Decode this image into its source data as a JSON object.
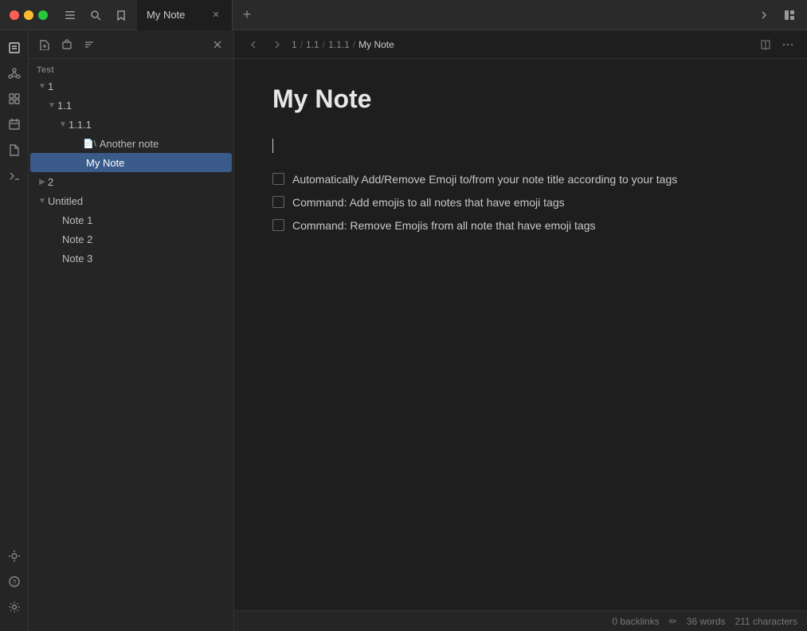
{
  "titlebar": {
    "tab_label": "My Note",
    "new_tab_label": "+"
  },
  "toolbar": {
    "new_note_label": "✎",
    "move_label": "⊞",
    "sort_label": "≡",
    "close_label": "✕"
  },
  "sidebar_icons": {
    "notes_icon": "📝",
    "graph_icon": "⬡",
    "grid_icon": "⊞",
    "calendar_icon": "📅",
    "file_icon": "📄",
    "terminal_icon": ">_",
    "plugin_icon": "⚙",
    "help_icon": "?",
    "settings_icon": "⚙"
  },
  "file_tree": {
    "section_label": "Test",
    "items": [
      {
        "id": "1",
        "label": "1",
        "level": 0,
        "type": "folder",
        "expanded": true,
        "chevron": "▼"
      },
      {
        "id": "1.1",
        "label": "1.1",
        "level": 1,
        "type": "folder",
        "expanded": true,
        "chevron": "▼"
      },
      {
        "id": "1.1.1",
        "label": "1.1.1",
        "level": 2,
        "type": "folder",
        "expanded": true,
        "chevron": "▼"
      },
      {
        "id": "another-note",
        "label": "Another note",
        "level": 3,
        "type": "note",
        "icon": "📄"
      },
      {
        "id": "my-note",
        "label": "My Note",
        "level": 3,
        "type": "note",
        "icon": ""
      },
      {
        "id": "2",
        "label": "2",
        "level": 0,
        "type": "folder",
        "expanded": false,
        "chevron": "▶"
      },
      {
        "id": "untitled",
        "label": "Untitled",
        "level": 0,
        "type": "folder",
        "expanded": true,
        "chevron": "▼"
      },
      {
        "id": "note-1",
        "label": "Note 1",
        "level": 1,
        "type": "note",
        "icon": ""
      },
      {
        "id": "note-2",
        "label": "Note 2",
        "level": 1,
        "type": "note",
        "icon": ""
      },
      {
        "id": "note-3",
        "label": "Note 3",
        "level": 1,
        "type": "note",
        "icon": ""
      }
    ]
  },
  "editor": {
    "breadcrumb": {
      "parts": [
        "1",
        "1.1",
        "1.1.1",
        "My Note"
      ],
      "separators": [
        "/",
        "/",
        "/"
      ]
    },
    "note_title": "My Note",
    "todo_items": [
      {
        "id": "todo-1",
        "text": "Automatically Add/Remove Emoji to/from your note title according to your tags",
        "checked": false
      },
      {
        "id": "todo-2",
        "text": "Command: Add emojis to all notes  that have emoji tags",
        "checked": false
      },
      {
        "id": "todo-3",
        "text": "Command: Remove Emojis from all note that have emoji tags",
        "checked": false
      }
    ]
  },
  "status_bar": {
    "backlinks_label": "0 backlinks",
    "words_label": "36 words",
    "chars_label": "211 characters",
    "edit_icon": "✏"
  }
}
